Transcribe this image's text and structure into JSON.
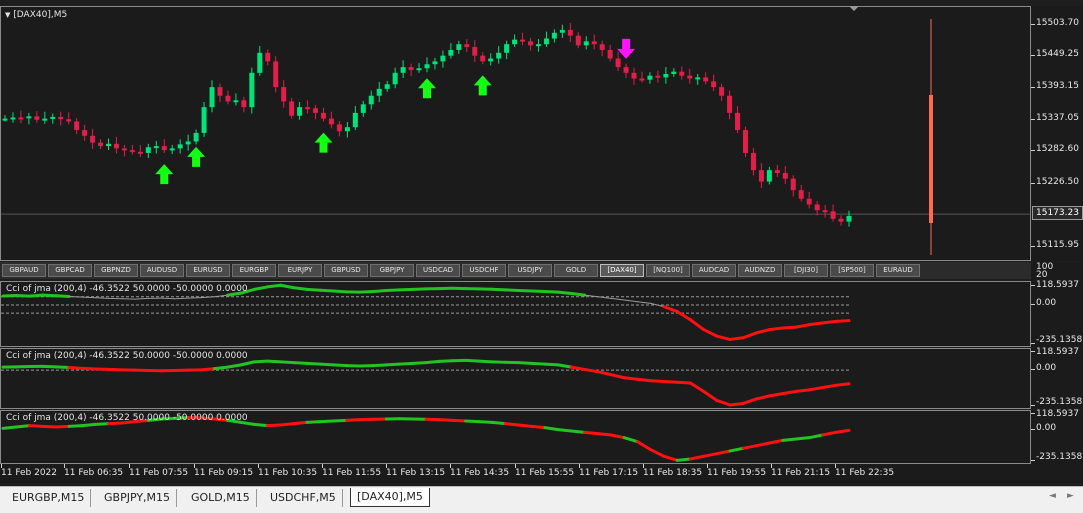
{
  "main_chart": {
    "title": "[DAX40],M5",
    "price_labels": [
      "15503.70",
      "15449.25",
      "15393.15",
      "15337.05",
      "15282.60",
      "15226.50",
      "15115.95"
    ],
    "current_price": "15173.23",
    "price_range": [
      15093,
      15535
    ],
    "close_series": [
      15340,
      15342,
      15341,
      15344,
      15338,
      15340,
      15343,
      15339,
      15335,
      15320,
      15310,
      15298,
      15292,
      15296,
      15288,
      15285,
      15282,
      15280,
      15290,
      15292,
      15285,
      15288,
      15295,
      15300,
      15315,
      15360,
      15395,
      15380,
      15370,
      15372,
      15360,
      15420,
      15455,
      15440,
      15395,
      15370,
      15345,
      15360,
      15358,
      15350,
      15340,
      15330,
      15318,
      15325,
      15350,
      15365,
      15380,
      15392,
      15400,
      15420,
      15430,
      15425,
      15428,
      15435,
      15440,
      15450,
      15460,
      15470,
      15465,
      15450,
      15440,
      15445,
      15455,
      15470,
      15478,
      15475,
      15468,
      15470,
      15480,
      15490,
      15495,
      15485,
      15468,
      15475,
      15470,
      15460,
      15445,
      15430,
      15420,
      15410,
      15408,
      15415,
      15412,
      15418,
      15422,
      15415,
      15410,
      15412,
      15405,
      15395,
      15380,
      15350,
      15320,
      15280,
      15250,
      15230,
      15250,
      15245,
      15235,
      15215,
      15200,
      15190,
      15180,
      15178,
      15165,
      15160,
      15170
    ],
    "buy_arrows": [
      {
        "index": 20
      },
      {
        "index": 24
      },
      {
        "index": 40
      },
      {
        "index": 53
      },
      {
        "index": 60
      }
    ],
    "sell_arrows": [
      {
        "index": 78
      }
    ],
    "colors": {
      "bull": "#00e37a",
      "bear": "#e0204a",
      "buy_arrow": "#13ff13",
      "sell_arrow": "#ff14ff",
      "marker": "#ff6a50"
    }
  },
  "symbol_bar": {
    "buttons": [
      "GBPAUD",
      "GBPCAD",
      "GBPNZD",
      "AUDUSD",
      "EURUSD",
      "EURGBP",
      "EURJPY",
      "GBPUSD",
      "GBPJPY",
      "USDCAD",
      "USDCHF",
      "USDJPY",
      "GOLD",
      "[DAX40]",
      "[NQ100]",
      "AUDCAD",
      "AUDNZD",
      "[DJI30]",
      "[SP500]",
      "EURAUD"
    ],
    "active": "[DAX40]",
    "scale_labels": [
      "100",
      "20"
    ]
  },
  "indicators": [
    {
      "label": "Cci of jma (200,4) -46.3522 50.0000 -50.0000 0.0000",
      "levels": [
        "118.5937",
        "0.00",
        "-235.1358"
      ],
      "values": [
        55,
        58,
        54,
        60,
        56,
        52,
        48,
        44,
        40,
        38,
        36,
        40,
        42,
        38,
        42,
        45,
        50,
        60,
        72,
        95,
        110,
        120,
        105,
        95,
        90,
        85,
        80,
        78,
        82,
        88,
        92,
        95,
        98,
        100,
        102,
        100,
        98,
        96,
        92,
        88,
        85,
        82,
        78,
        70,
        60,
        50,
        40,
        30,
        20,
        10,
        -10,
        -40,
        -90,
        -150,
        -190,
        -210,
        -200,
        -170,
        -150,
        -140,
        -135,
        -120,
        -110,
        -100,
        -95
      ],
      "green_until": 50,
      "mode": "pane1"
    },
    {
      "label": "Cci of jma (200,4) -46.3522 50.0000 -50.0000 0.0000",
      "levels": [
        "118.5937",
        "0.00",
        "-235.1358"
      ],
      "values": [
        20,
        22,
        24,
        25,
        22,
        18,
        12,
        8,
        5,
        2,
        0,
        -2,
        -4,
        -2,
        0,
        2,
        10,
        20,
        35,
        55,
        60,
        55,
        50,
        45,
        40,
        35,
        30,
        28,
        30,
        35,
        40,
        45,
        50,
        58,
        62,
        65,
        60,
        55,
        52,
        50,
        45,
        40,
        35,
        20,
        5,
        -10,
        -30,
        -50,
        -60,
        -70,
        -75,
        -80,
        -85,
        -140,
        -200,
        -230,
        -220,
        -190,
        -170,
        -155,
        -140,
        -130,
        -115,
        -100,
        -90
      ],
      "mode": "pane2"
    },
    {
      "label": "Cci of jma (200,4) -46.3522 50.0000 -50.0000 0.0000",
      "levels": [
        "118.5937",
        "0.00",
        "-235.1358"
      ],
      "values": [
        10,
        20,
        30,
        25,
        20,
        25,
        30,
        40,
        45,
        50,
        60,
        70,
        80,
        85,
        90,
        88,
        80,
        70,
        55,
        40,
        30,
        35,
        45,
        55,
        60,
        65,
        70,
        75,
        78,
        80,
        82,
        80,
        78,
        75,
        70,
        65,
        60,
        55,
        45,
        35,
        25,
        15,
        0,
        -10,
        -20,
        -30,
        -40,
        -60,
        -90,
        -150,
        -200,
        -230,
        -220,
        -200,
        -180,
        -160,
        -140,
        -120,
        -100,
        -80,
        -70,
        -60,
        -40,
        -20,
        -5
      ],
      "mode": "pane3"
    }
  ],
  "time_axis": {
    "labels": [
      "11 Feb 2022",
      "11 Feb 06:35",
      "11 Feb 07:55",
      "11 Feb 09:15",
      "11 Feb 10:35",
      "11 Feb 11:55",
      "11 Feb 13:15",
      "11 Feb 14:35",
      "11 Feb 15:55",
      "11 Feb 17:15",
      "11 Feb 18:35",
      "11 Feb 19:55",
      "11 Feb 21:15",
      "11 Feb 22:35"
    ]
  },
  "tabs": [
    {
      "label": "EURGBP,M15",
      "active": false
    },
    {
      "label": "GBPJPY,M15",
      "active": false
    },
    {
      "label": "GOLD,M15",
      "active": false
    },
    {
      "label": "USDCHF,M5",
      "active": false
    },
    {
      "label": "[DAX40],M5",
      "active": true
    }
  ],
  "tab_arrows": [
    "◄",
    "►"
  ]
}
